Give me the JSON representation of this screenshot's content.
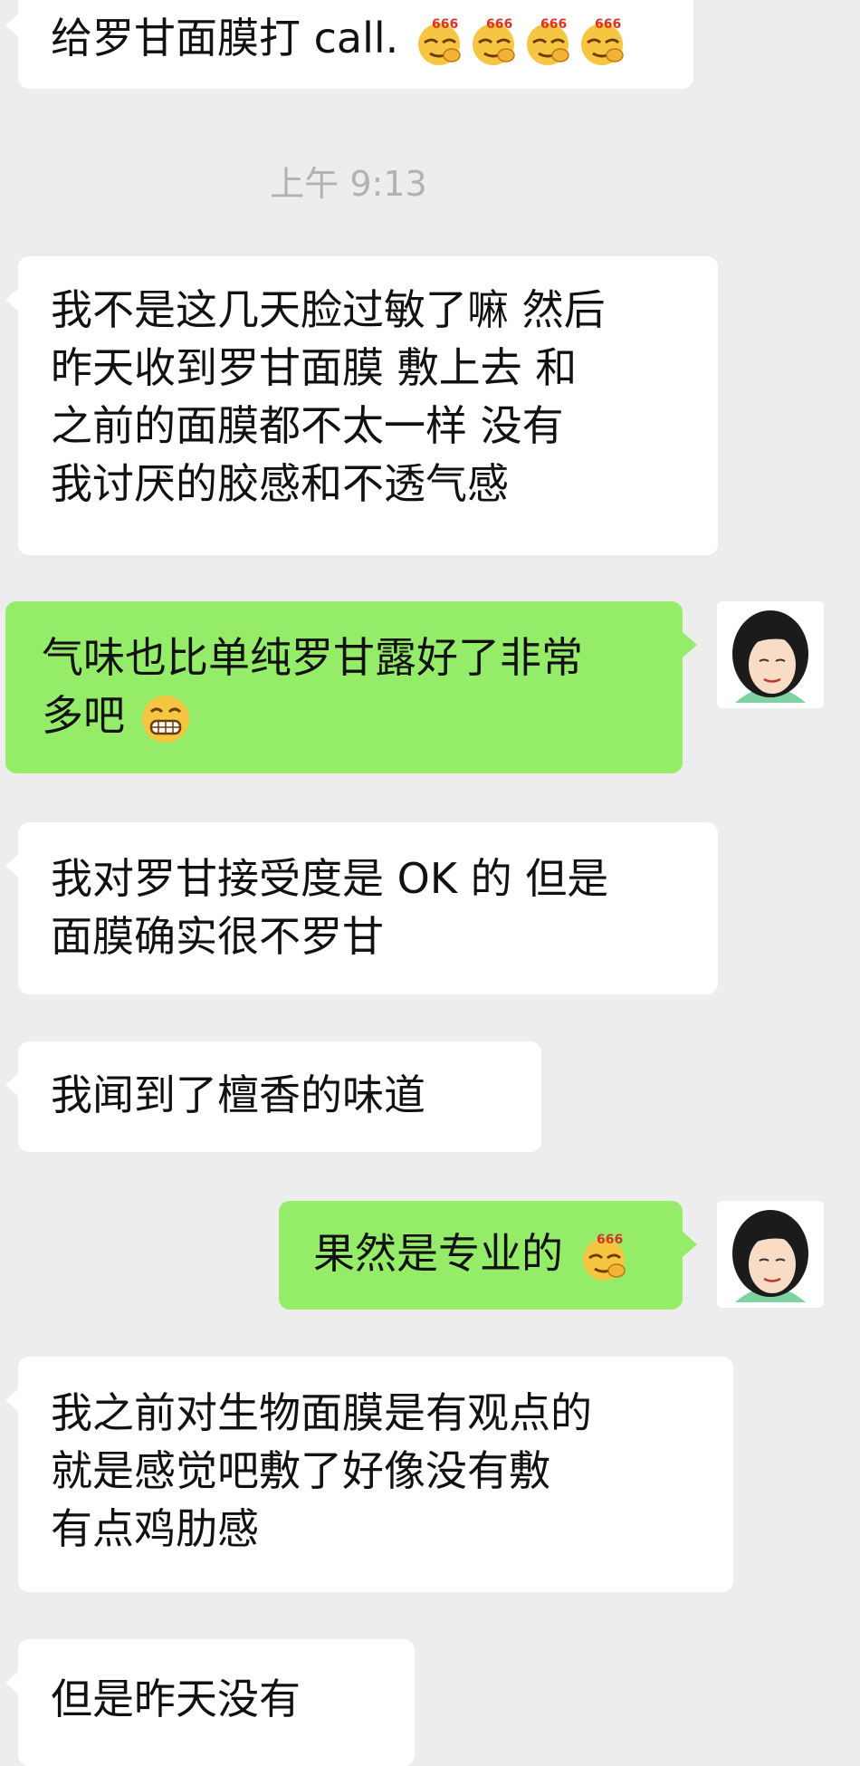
{
  "chat": {
    "timestamp": "上午 9:13",
    "messages": [
      {
        "side": "in",
        "lines": [
          "给罗甘面膜打 call."
        ],
        "emoji": [
          "666-icon",
          "666-icon",
          "666-icon",
          "666-icon"
        ]
      },
      {
        "side": "in",
        "lines": [
          "我不是这几天脸过敏了嘛  然后",
          "昨天收到罗甘面膜  敷上去  和",
          "之前的面膜都不太一样    没有",
          "我讨厌的胶感和不透气感"
        ]
      },
      {
        "side": "out",
        "lines": [
          "气味也比单纯罗甘露好了非常",
          "多吧"
        ],
        "emoji": [
          "grin-icon"
        ]
      },
      {
        "side": "in",
        "lines": [
          "我对罗甘接受度是 OK 的   但是",
          "面膜确实很不罗甘"
        ]
      },
      {
        "side": "in",
        "lines": [
          "我闻到了檀香的味道"
        ]
      },
      {
        "side": "out",
        "lines": [
          "果然是专业的"
        ],
        "emoji": [
          "666-icon"
        ]
      },
      {
        "side": "in",
        "lines": [
          "我之前对生物面膜是有观点的",
          "就是感觉吧敷了好像没有敷",
          "有点鸡肋感"
        ]
      },
      {
        "side": "in",
        "lines": [
          "但是昨天没有"
        ]
      }
    ],
    "emoji_badge": "666"
  }
}
